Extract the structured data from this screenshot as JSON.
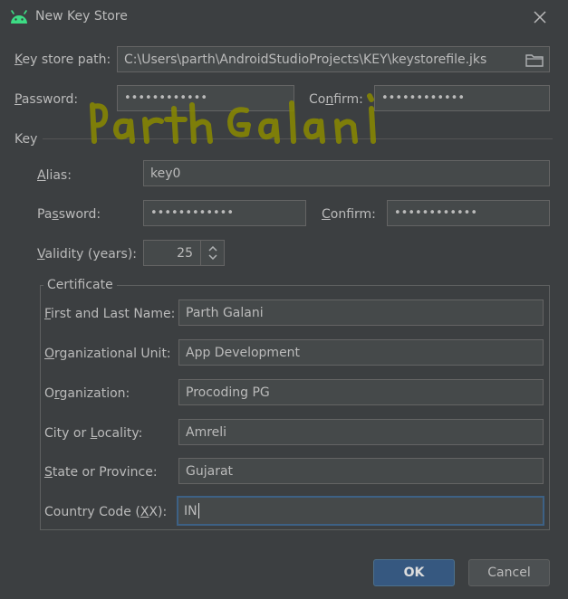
{
  "window": {
    "title": "New Key Store"
  },
  "keystore": {
    "path_label": "Key store path:",
    "path_value": "C:\\Users\\parth\\AndroidStudioProjects\\KEY\\keystorefile.jks",
    "password_label": "Password:",
    "password_value": "••••••••••••",
    "confirm_label": "Confirm:",
    "confirm_value": "••••••••••••"
  },
  "key": {
    "section_label": "Key",
    "alias_label": "Alias:",
    "alias_value": "key0",
    "password_label": "Password:",
    "password_value": "••••••••••••",
    "confirm_label": "Confirm:",
    "confirm_value": "••••••••••••",
    "validity_label": "Validity (years):",
    "validity_value": "25"
  },
  "certificate": {
    "title": "Certificate",
    "fields": [
      {
        "label": "First and Last Name:",
        "value": "Parth Galani"
      },
      {
        "label": "Organizational Unit:",
        "value": "App Development"
      },
      {
        "label": "Organization:",
        "value": "Procoding PG"
      },
      {
        "label": "City or Locality:",
        "value": "Amreli"
      },
      {
        "label": "State or Province:",
        "value": "Gujarat"
      },
      {
        "label": "Country Code (XX):",
        "value": "IN"
      }
    ]
  },
  "buttons": {
    "ok": "OK",
    "cancel": "Cancel"
  },
  "watermark": {
    "text": "Parth Galani"
  },
  "colors": {
    "background": "#3c3f41",
    "field": "#45494a",
    "focus": "#3d6185",
    "ok_button": "#365880",
    "android_green": "#3ddc84",
    "watermark": "#8a8a00"
  },
  "icons": {
    "app": "android-icon",
    "close": "close-icon",
    "folder": "folder-icon",
    "spinner_up": "chevron-up-icon",
    "spinner_down": "chevron-down-icon"
  }
}
